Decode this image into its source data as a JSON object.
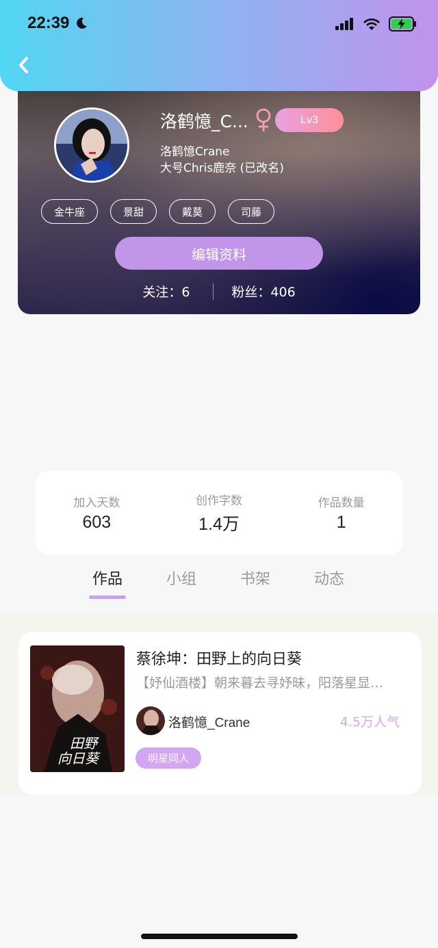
{
  "status_bar": {
    "time": "22:39",
    "icons": [
      "moon-icon",
      "signal-icon",
      "wifi-icon",
      "battery-charging-icon"
    ]
  },
  "header": {
    "back_icon": "chevron-left-icon",
    "gradient_colors": [
      "#52d6f3",
      "#c193ec"
    ]
  },
  "profile": {
    "name": "洛鹤憶_C...",
    "gender_icon": "female-icon",
    "level": "Lv3",
    "subname": "洛鹤憶Crane",
    "alt_account": "大号Chris鹿奈 (已改名)",
    "tags": [
      "金牛座",
      "景甜",
      "戴莫",
      "司藤"
    ],
    "edit_button": "编辑资料",
    "following_label": "关注：",
    "following_count": "6",
    "fans_label": "粉丝：",
    "fans_count": "406"
  },
  "stats": [
    {
      "label": "加入天数",
      "value": "603"
    },
    {
      "label": "创作字数",
      "value": "1.4万"
    },
    {
      "label": "作品数量",
      "value": "1"
    }
  ],
  "tabs": [
    {
      "label": "作品",
      "active": true
    },
    {
      "label": "小组",
      "active": false
    },
    {
      "label": "书架",
      "active": false
    },
    {
      "label": "动态",
      "active": false
    }
  ],
  "works": [
    {
      "title": "蔡徐坤：田野上的向日葵",
      "description": "【妤仙酒楼】朝来暮去寻妤昧，阳落星显…",
      "author": "洛鹤憶_Crane",
      "popularity": "4.5万人气",
      "genre": "明星同人"
    }
  ],
  "colors": {
    "accent_purple": "#c095ea",
    "popularity_text": "#d2abe8"
  }
}
